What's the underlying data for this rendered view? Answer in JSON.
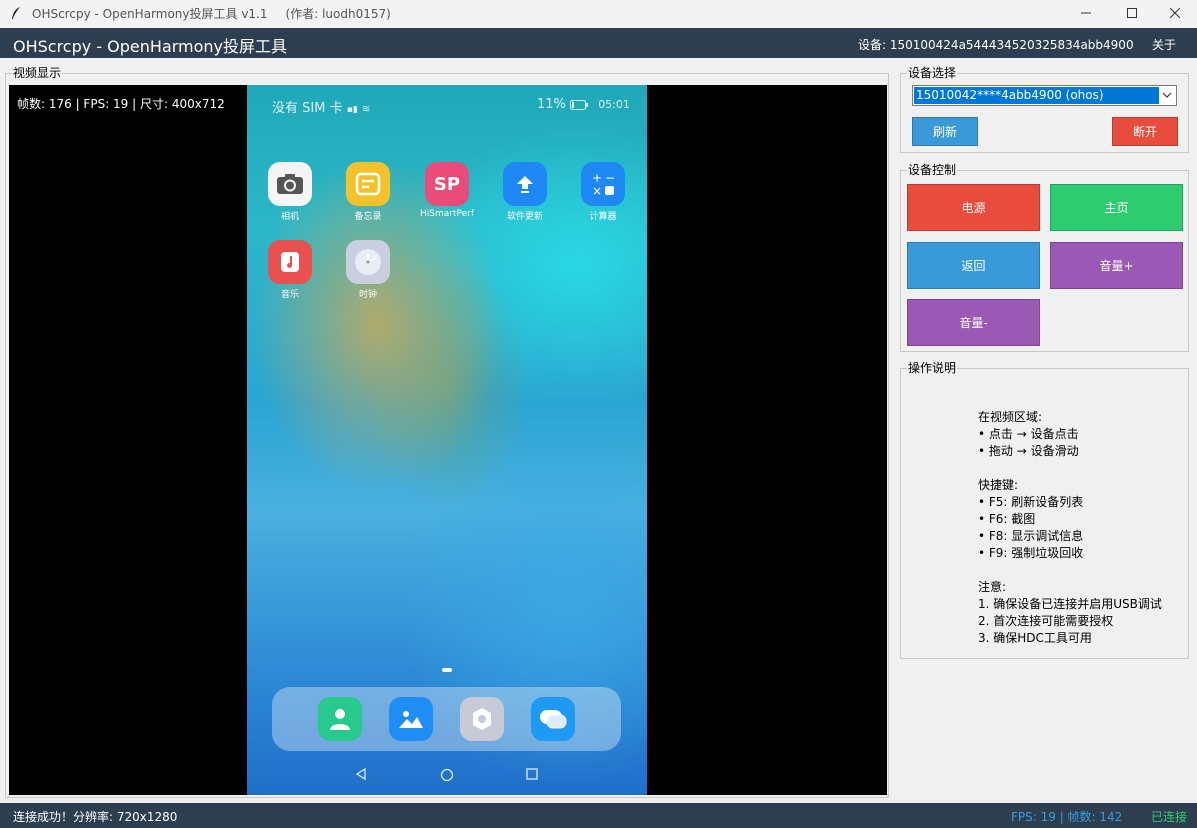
{
  "window": {
    "title": "OHScrcpy - OpenHarmony投屏工具 v1.1",
    "author": "(作者: luodh0157)"
  },
  "header": {
    "title": "OHScrcpy - OpenHarmony投屏工具",
    "device": "设备: 150100424a544434520325834abb4900",
    "about": "关于"
  },
  "video": {
    "legend": "视频显示",
    "info": "帧数: 176 | FPS: 19 | 尺寸: 400x712"
  },
  "phone": {
    "status_left": "没有 SIM 卡",
    "battery": "11%",
    "clock": "05:01",
    "apps": [
      {
        "label": "相机",
        "color": "#f5f5f5",
        "icon": "camera-icon"
      },
      {
        "label": "备忘录",
        "color": "#f6c22c",
        "icon": "memo-icon"
      },
      {
        "label": "HiSmartPerf",
        "color": "#e94b7a",
        "icon": "sp-icon",
        "glyph": "SP"
      },
      {
        "label": "软件更新",
        "color": "#1e88f5",
        "icon": "update-icon"
      },
      {
        "label": "计算器",
        "color": "#1e88f5",
        "icon": "calculator-icon"
      },
      {
        "label": "音乐",
        "color": "#e8514f",
        "icon": "music-icon"
      },
      {
        "label": "时钟",
        "color": "#c9cfe0",
        "icon": "clock-icon"
      }
    ],
    "dock": [
      {
        "icon": "contacts-icon",
        "color": "#27c98d"
      },
      {
        "icon": "gallery-icon",
        "color": "#1e8ef5"
      },
      {
        "icon": "settings-icon",
        "color": "#c7cbd8"
      },
      {
        "icon": "messages-icon",
        "color": "#1e9af5"
      }
    ]
  },
  "device_select": {
    "legend": "设备选择",
    "selected": "15010042****4abb4900 (ohos)",
    "refresh": "刷新",
    "disconnect": "断开"
  },
  "device_control": {
    "legend": "设备控制",
    "power": "电源",
    "home": "主页",
    "back": "返回",
    "volume_up": "音量+",
    "volume_down": "音量-"
  },
  "instructions": {
    "legend": "操作说明",
    "lines": [
      "在视频区域:",
      "• 点击 → 设备点击",
      "• 拖动 → 设备滑动",
      "",
      "快捷键:",
      "• F5: 刷新设备列表",
      "• F6: 截图",
      "• F8: 显示调试信息",
      "• F9: 强制垃圾回收",
      "",
      "注意:",
      "1. 确保设备已连接并启用USB调试",
      "2. 首次连接可能需要授权",
      "3. 确保HDC工具可用"
    ]
  },
  "statusbar": {
    "message": "连接成功！分辨率: 720x1280",
    "fps": "FPS: 19 | 帧数: 142",
    "connection": "已连接"
  },
  "colors": {
    "header_bg": "#2d3e50",
    "blue": "#3a9ad9",
    "red": "#e74c3c",
    "green": "#2ecc71",
    "purple": "#9b59b6"
  }
}
